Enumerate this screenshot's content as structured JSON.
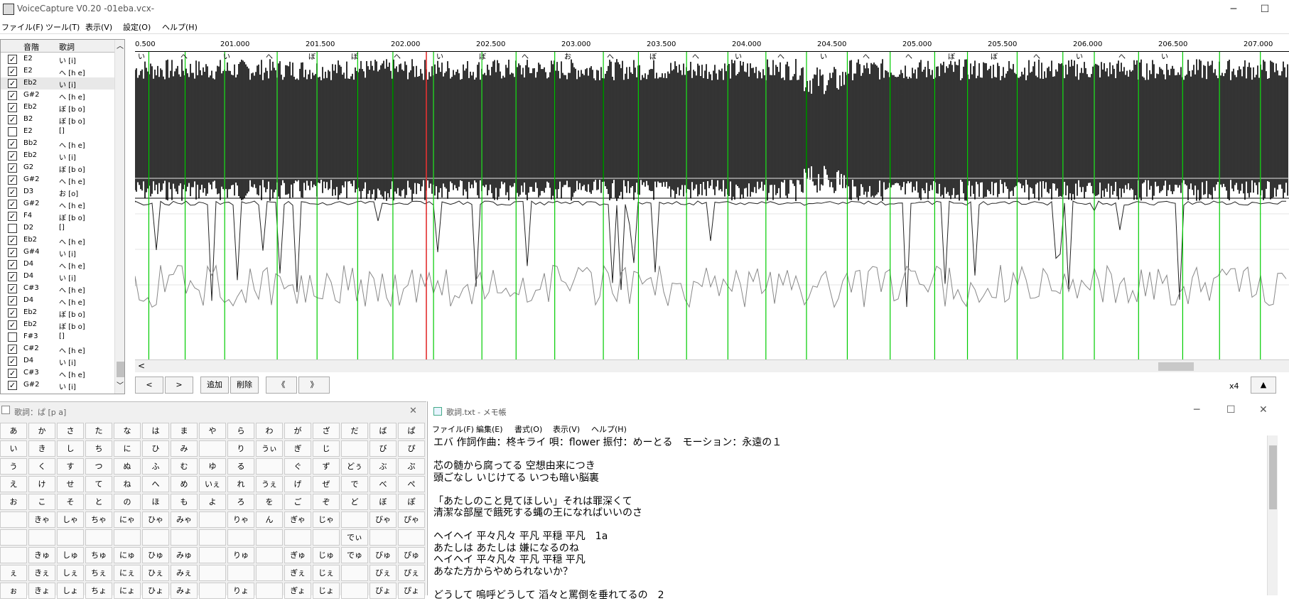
{
  "app": {
    "title": "VoiceCapture V0.20 -01eba.vcx-",
    "minimize": "─",
    "maximize": "☐",
    "close": "✕"
  },
  "menu": [
    "ファイル(F)",
    "ツール(T)",
    "表示(V)",
    "設定(O)",
    "ヘルプ(H)"
  ],
  "notes": {
    "header_pitch": "音階",
    "header_lyric": "歌詞",
    "scroll_up": "︿",
    "scroll_down": "﹀",
    "rows": [
      {
        "checked": true,
        "pitch": "E2",
        "lyric": "い [i]"
      },
      {
        "checked": true,
        "pitch": "E2",
        "lyric": "へ [h e]"
      },
      {
        "checked": true,
        "pitch": "Eb2",
        "lyric": "い [i]",
        "selected": true
      },
      {
        "checked": true,
        "pitch": "G#2",
        "lyric": "へ [h e]"
      },
      {
        "checked": true,
        "pitch": "Eb2",
        "lyric": "ぼ [b o]"
      },
      {
        "checked": true,
        "pitch": "B2",
        "lyric": "ぼ [b o]"
      },
      {
        "checked": false,
        "pitch": "E2",
        "lyric": "[]"
      },
      {
        "checked": true,
        "pitch": "Bb2",
        "lyric": "へ [h e]"
      },
      {
        "checked": true,
        "pitch": "Eb2",
        "lyric": "い [i]"
      },
      {
        "checked": true,
        "pitch": "G2",
        "lyric": "ぼ [b o]"
      },
      {
        "checked": true,
        "pitch": "G#2",
        "lyric": "へ [h e]"
      },
      {
        "checked": true,
        "pitch": "D3",
        "lyric": "お [o]"
      },
      {
        "checked": true,
        "pitch": "G#2",
        "lyric": "へ [h e]"
      },
      {
        "checked": true,
        "pitch": "F4",
        "lyric": "ぼ [b o]"
      },
      {
        "checked": false,
        "pitch": "D2",
        "lyric": "[]"
      },
      {
        "checked": true,
        "pitch": "Eb2",
        "lyric": "へ [h e]"
      },
      {
        "checked": true,
        "pitch": "G#4",
        "lyric": "い [i]"
      },
      {
        "checked": true,
        "pitch": "D4",
        "lyric": "へ [h e]"
      },
      {
        "checked": true,
        "pitch": "D4",
        "lyric": "い [i]"
      },
      {
        "checked": true,
        "pitch": "C#3",
        "lyric": "へ [h e]"
      },
      {
        "checked": true,
        "pitch": "D4",
        "lyric": "へ [h e]"
      },
      {
        "checked": true,
        "pitch": "Eb2",
        "lyric": "ぼ [b o]"
      },
      {
        "checked": true,
        "pitch": "Eb2",
        "lyric": "ぼ [b o]"
      },
      {
        "checked": false,
        "pitch": "F#3",
        "lyric": "[]"
      },
      {
        "checked": true,
        "pitch": "C#2",
        "lyric": "へ [h e]"
      },
      {
        "checked": true,
        "pitch": "D4",
        "lyric": "い [i]"
      },
      {
        "checked": true,
        "pitch": "C#3",
        "lyric": "へ [h e]"
      },
      {
        "checked": true,
        "pitch": "G#2",
        "lyric": "い [i]"
      }
    ]
  },
  "timeline": {
    "ticks": [
      "0.500",
      "201.000",
      "201.500",
      "202.000",
      "202.500",
      "203.000",
      "203.500",
      "204.000",
      "204.500",
      "205.000",
      "205.500",
      "206.000",
      "206.500",
      "207.000"
    ],
    "segment_marks": [
      "い",
      "へ",
      "い",
      "へ",
      "ぼ",
      "ぼ",
      "へ",
      "い",
      "ぼ",
      "へ",
      "お",
      "へ",
      "ぼ",
      "へ",
      "い",
      "へ",
      "い",
      "へ",
      "へ",
      "ぼ",
      "ぼ",
      "へ",
      "い",
      "へ",
      "い"
    ]
  },
  "toolbar": {
    "prev": "<",
    "next": ">",
    "add": "追加",
    "delete": "削除",
    "rewind": "《",
    "forward": "》",
    "zoom": "x4",
    "up": "▲",
    "down": "▼",
    "scroll_left": "<"
  },
  "kana": {
    "title": "歌詞：ぱ [p a]",
    "close": "✕",
    "rows": [
      [
        "あ",
        "か",
        "さ",
        "た",
        "な",
        "は",
        "ま",
        "や",
        "ら",
        "わ",
        "が",
        "ざ",
        "だ",
        "ば",
        "ぱ"
      ],
      [
        "い",
        "き",
        "し",
        "ち",
        "に",
        "ひ",
        "み",
        "",
        "り",
        "うぃ",
        "ぎ",
        "じ",
        "",
        "び",
        "ぴ"
      ],
      [
        "う",
        "く",
        "す",
        "つ",
        "ぬ",
        "ふ",
        "む",
        "ゆ",
        "る",
        "",
        "ぐ",
        "ず",
        "どぅ",
        "ぶ",
        "ぷ"
      ],
      [
        "え",
        "け",
        "せ",
        "て",
        "ね",
        "へ",
        "め",
        "いぇ",
        "れ",
        "うぇ",
        "げ",
        "ぜ",
        "で",
        "べ",
        "ぺ"
      ],
      [
        "お",
        "こ",
        "そ",
        "と",
        "の",
        "ほ",
        "も",
        "よ",
        "ろ",
        "を",
        "ご",
        "ぞ",
        "ど",
        "ぼ",
        "ぽ"
      ],
      [
        "",
        "きゃ",
        "しゃ",
        "ちゃ",
        "にゃ",
        "ひゃ",
        "みゃ",
        "",
        "りゃ",
        "ん",
        "ぎゃ",
        "じゃ",
        "",
        "びゃ",
        "ぴゃ"
      ],
      [
        "",
        "",
        "",
        "",
        "",
        "",
        "",
        "",
        "",
        "",
        "",
        "",
        "でぃ",
        "",
        ""
      ],
      [
        "",
        "きゅ",
        "しゅ",
        "ちゅ",
        "にゅ",
        "ひゅ",
        "みゅ",
        "",
        "りゅ",
        "",
        "ぎゅ",
        "じゅ",
        "でゅ",
        "びゅ",
        "ぴゅ"
      ],
      [
        "ぇ",
        "きぇ",
        "しぇ",
        "ちぇ",
        "にぇ",
        "ひぇ",
        "みぇ",
        "",
        "",
        "",
        "ぎぇ",
        "じぇ",
        "",
        "びぇ",
        "ぴぇ"
      ],
      [
        "ぉ",
        "きょ",
        "しょ",
        "ちょ",
        "にょ",
        "ひょ",
        "みょ",
        "",
        "りょ",
        "",
        "ぎょ",
        "じょ",
        "",
        "びょ",
        "ぴょ"
      ]
    ]
  },
  "notepad": {
    "title": "歌詞.txt - メモ帳",
    "menu": [
      "ファイル(F)",
      "編集(E)",
      "書式(O)",
      "表示(V)",
      "ヘルプ(H)"
    ],
    "lines": [
      "エバ 作詞作曲：柊キライ 唄：flower 振付：めーとる　モーション：永遠の１",
      "",
      "芯の髄から腐ってる 空想由来につき",
      "頭ごなし いじけてる いつも暗い脳裏",
      "",
      "「あたしのこと見てほしい」それは罪深くて",
      "清潔な部屋で餓死する蝿の王になればいいのさ",
      "",
      "ヘイヘイ 平々凡々 平凡 平穏 平凡　1a",
      "あたしは あたしは 嫌になるのね",
      "ヘイヘイ 平々凡々 平凡 平穏 平凡",
      "あなた方からやめられないか？",
      "",
      "どうして 嗚呼どうして 滔々と罵倒を垂れてるの　2"
    ]
  },
  "colors": {
    "segment": "#00cc00",
    "cursor": "#e02020",
    "wave": "#000000"
  }
}
